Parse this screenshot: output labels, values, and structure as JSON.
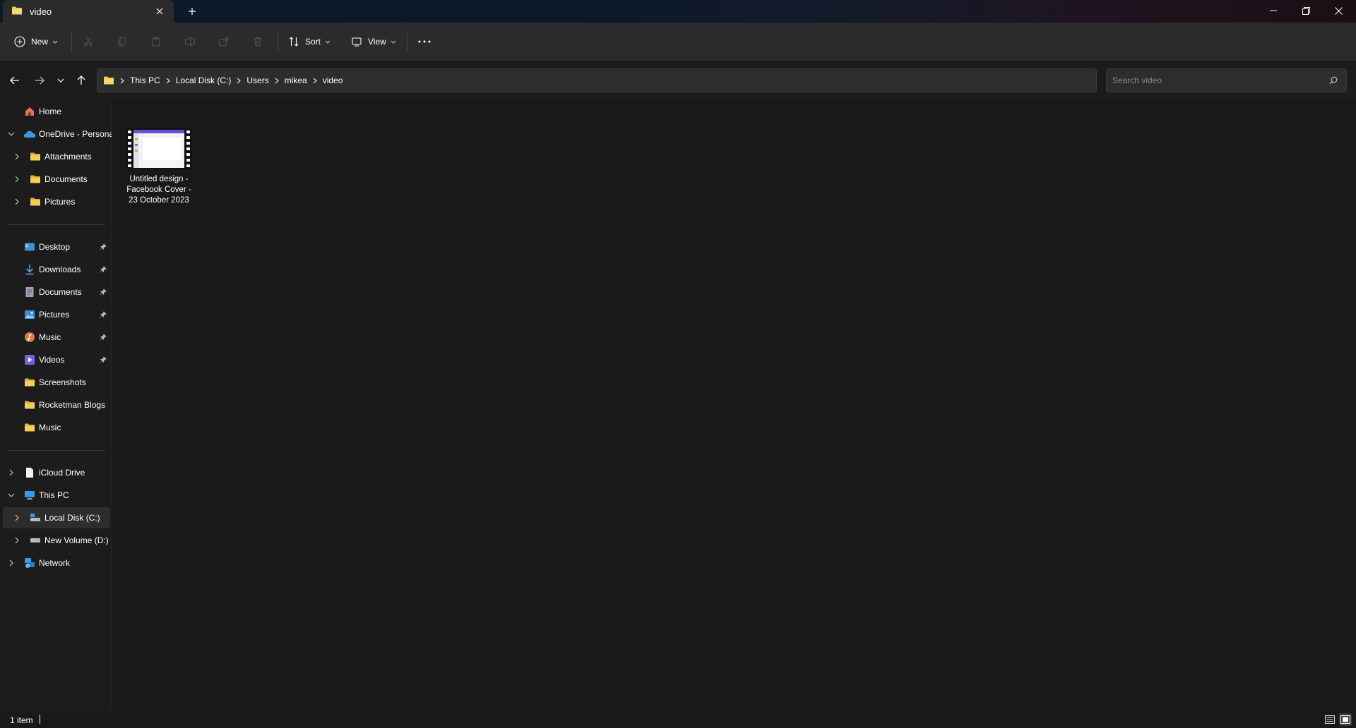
{
  "window": {
    "tab_title": "video",
    "new_tab_glyph": "+",
    "controls": [
      "minimize-icon",
      "restore-icon",
      "close-icon"
    ]
  },
  "toolbar": {
    "new_label": "New",
    "sort_label": "Sort",
    "view_label": "View",
    "more_glyph": "···",
    "disabled_actions": [
      "cut-icon",
      "copy-icon",
      "paste-icon",
      "rename-icon",
      "share-icon",
      "delete-icon"
    ]
  },
  "address": {
    "breadcrumbs": [
      "This PC",
      "Local Disk (C:)",
      "Users",
      "mikea",
      "video"
    ]
  },
  "search": {
    "placeholder": "Search video"
  },
  "sidebar": {
    "home": "Home",
    "onedrive": "OneDrive - Persona",
    "onedrive_children": [
      "Attachments",
      "Documents",
      "Pictures"
    ],
    "quick_access": [
      {
        "label": "Desktop",
        "icon": "desktop-icon",
        "pinned": true
      },
      {
        "label": "Downloads",
        "icon": "downloads-icon",
        "pinned": true
      },
      {
        "label": "Documents",
        "icon": "documents-icon",
        "pinned": true
      },
      {
        "label": "Pictures",
        "icon": "pictures-icon",
        "pinned": true
      },
      {
        "label": "Music",
        "icon": "music-icon",
        "pinned": true
      },
      {
        "label": "Videos",
        "icon": "videos-icon",
        "pinned": true
      },
      {
        "label": "Screenshots",
        "icon": "folder-icon",
        "pinned": false
      },
      {
        "label": "Rocketman Blogs",
        "icon": "folder-icon",
        "pinned": false
      },
      {
        "label": "Music",
        "icon": "folder-icon",
        "pinned": false
      }
    ],
    "icloud": "iCloud Drive",
    "this_pc": "This PC",
    "local_disk": "Local Disk (C:)",
    "new_volume": "New Volume (D:)",
    "network": "Network"
  },
  "files": [
    {
      "name": "Untitled design - Facebook Cover - 23 October 2023",
      "type": "video"
    }
  ],
  "status": {
    "item_count": "1 item"
  },
  "colors": {
    "folder": "#f2c94c",
    "accent": "#4aa3f0",
    "background": "#191919",
    "toolbar": "#2b2b2b"
  }
}
